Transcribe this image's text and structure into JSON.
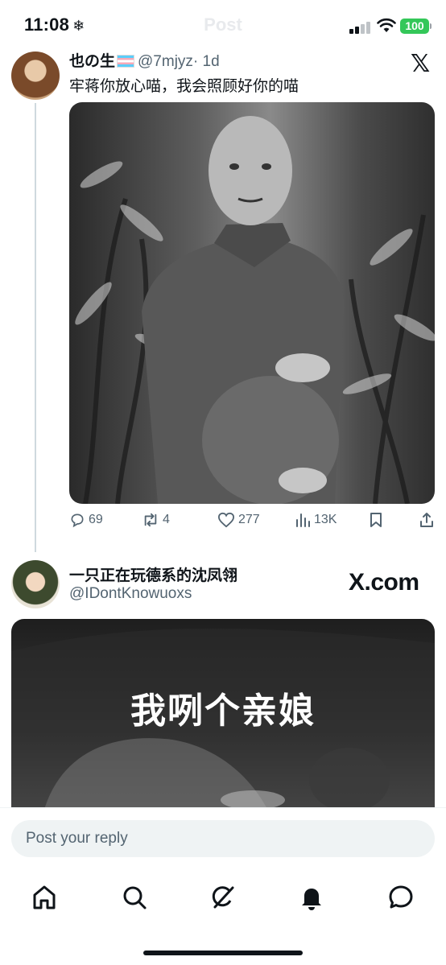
{
  "status_bar": {
    "time": "11:08",
    "focus_icon": "snowflake-icon",
    "header_title": "Post",
    "battery": "100",
    "battery_color": "#34c759"
  },
  "tweet": {
    "display_name": "也の生",
    "handle": "@7mjyz",
    "time": "· 1d",
    "text": "牢蒋你放心喵，我会照顾好你的喵",
    "platform_logo": "x-logo",
    "media": "black-and-white photo of a man in uniform",
    "actions": {
      "replies": "69",
      "reposts": "4",
      "likes": "277",
      "views": "13K"
    }
  },
  "quoted": {
    "display_name": "一只正在玩德系的沈凤翎",
    "handle": "@IDontKnowuoxs",
    "watermark": "X.com",
    "caption": "我咧个亲娘"
  },
  "reply": {
    "placeholder": "Post your reply"
  },
  "nav": {
    "items": [
      "home-icon",
      "search-icon",
      "grok-icon",
      "notifications-icon",
      "messages-icon"
    ]
  },
  "colors": {
    "text": "#0f1419",
    "secondary": "#536471",
    "divider": "#cfd9de"
  }
}
